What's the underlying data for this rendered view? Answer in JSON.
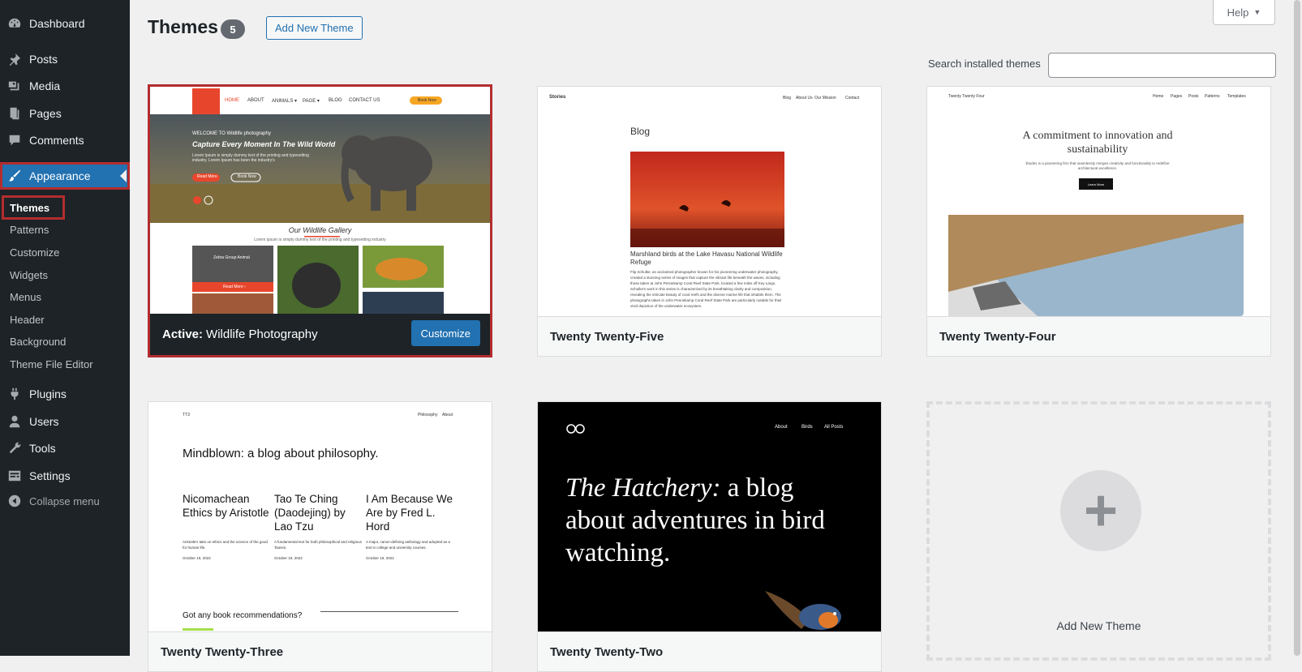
{
  "sidebar": {
    "items": [
      {
        "name": "dashboard",
        "label": "Dashboard",
        "icon": "dashboard-icon"
      },
      {
        "name": "posts",
        "label": "Posts",
        "icon": "pin-icon"
      },
      {
        "name": "media",
        "label": "Media",
        "icon": "media-icon"
      },
      {
        "name": "pages",
        "label": "Pages",
        "icon": "pages-icon"
      },
      {
        "name": "comments",
        "label": "Comments",
        "icon": "comment-icon"
      },
      {
        "name": "appearance",
        "label": "Appearance",
        "icon": "paintbrush-icon"
      },
      {
        "name": "plugins",
        "label": "Plugins",
        "icon": "plug-icon"
      },
      {
        "name": "users",
        "label": "Users",
        "icon": "user-icon"
      },
      {
        "name": "tools",
        "label": "Tools",
        "icon": "wrench-icon"
      },
      {
        "name": "settings",
        "label": "Settings",
        "icon": "settings-icon"
      },
      {
        "name": "collapse",
        "label": "Collapse menu",
        "icon": "collapse-icon"
      }
    ],
    "submenu": [
      "Themes",
      "Patterns",
      "Customize",
      "Widgets",
      "Menus",
      "Header",
      "Background",
      "Theme File Editor"
    ]
  },
  "header": {
    "title": "Themes",
    "count": "5",
    "add_new": "Add New Theme",
    "help": "Help"
  },
  "search": {
    "label": "Search installed themes",
    "value": ""
  },
  "themes": [
    {
      "name": "Wildlife Photography",
      "active_prefix": "Active:",
      "customize": "Customize"
    },
    {
      "name": "Twenty Twenty-Five"
    },
    {
      "name": "Twenty Twenty-Four"
    },
    {
      "name": "Twenty Twenty-Three"
    },
    {
      "name": "Twenty Twenty-Two"
    }
  ],
  "add_new_card": "Add New Theme",
  "previews": {
    "wildlife": {
      "nav": [
        "HOME",
        "ABOUT",
        "ANIMALS ▾",
        "PAGE ▾",
        "BLOG",
        "CONTACT US"
      ],
      "book": "Book Now",
      "welcome": "WELCOME TO Wildlife photography",
      "hero": "Capture Every Moment In The Wild World",
      "hero_sub": "Lorem Ipsum is simply dummy text of the printing and typesetting industry. Lorem Ipsum has been the industry's",
      "btn_read": "Read More",
      "btn_book": "Book Now",
      "gallery_title": "Our Wildlife Gallery",
      "gallery_sub": "Lorem ipsum is simply dummy text of the printing and typesetting industry",
      "card_title": "Zebra Group Animal",
      "card_btn": "Read More ›"
    },
    "tt5": {
      "brand": "Stories",
      "nav": [
        "Blog",
        "About Us",
        "Our Mission",
        "Contact"
      ],
      "heading": "Blog",
      "post_title": "Marshland birds at the Lake Havasu National Wildlife Refuge",
      "body": "Flip Schulke, an acclaimed photographer known for his pioneering underwater photography, created a stunning series of images that capture the vibrant life beneath the waves, including those taken at John Pennekamp Coral Reef State Park, located a few miles off Key Largo. Schulke's work in this series is characterized by its breathtaking clarity and composition, revealing the intricate beauty of coral reefs and the diverse marine life that inhabits them. The photographs taken in John Pennekamp Coral Reef State Park are particularly notable for their vivid depiction of the underwater ecosystem."
    },
    "tt4": {
      "brand": "Twenty Twenty Four",
      "nav": [
        "Home",
        "Pages",
        "Posts",
        "Patterns",
        "Templates"
      ],
      "heading": "A commitment to innovation and sustainability",
      "sub": "Études is a pioneering firm that seamlessly merges creativity and functionality to redefine architectural excellence.",
      "btn": "Learn More"
    },
    "tt3": {
      "brand": "TT3",
      "nav": [
        "Philosophy",
        "About"
      ],
      "heading": "Mindblown: a blog about philosophy.",
      "posts": [
        {
          "title": "Nicomachean Ethics by Aristotle",
          "desc": "Aristotle's take on ethics and the science of the good for human life.",
          "date": "October 19, 2022"
        },
        {
          "title": "Tao Te Ching (Daodejing) by Lao Tzu",
          "desc": "A fundamental text for both philosophical and religious Taoism.",
          "date": "October 19, 2022"
        },
        {
          "title": "I Am Because We Are by Fred L. Hord",
          "desc": "A major, canon-defining anthology and adopted as a text in college and university courses.",
          "date": "October 19, 2022"
        }
      ],
      "footer": "Got any book recommendations?"
    },
    "tt2": {
      "nav": [
        "About",
        "Birds",
        "All Posts"
      ],
      "heading_em": "The Hatchery:",
      "heading_rest": " a blog about adventures in bird watching."
    }
  }
}
